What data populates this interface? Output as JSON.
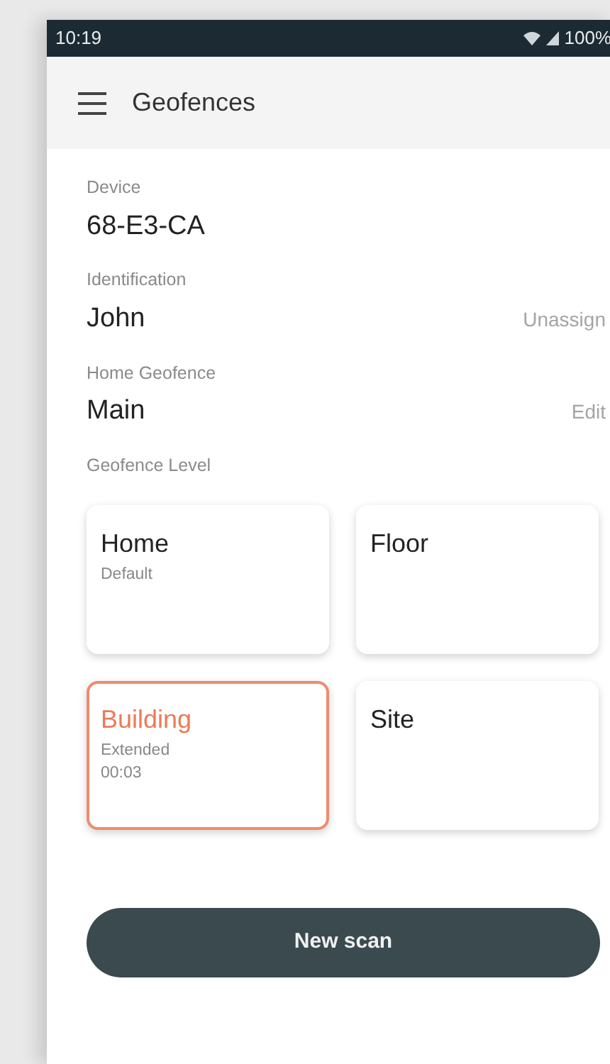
{
  "status_bar": {
    "time": "10:19",
    "battery": "100%"
  },
  "app_bar": {
    "title": "Geofences"
  },
  "fields": [
    {
      "label": "Device",
      "value": "68-E3-CA"
    },
    {
      "label": "Identification",
      "value": "John",
      "action": "Unassign"
    },
    {
      "label": "Home Geofence",
      "value": "Main",
      "action": "Edit"
    }
  ],
  "level_section": {
    "label": "Geofence Level"
  },
  "levels": [
    {
      "name": "Home",
      "lines": [
        "Default"
      ],
      "selected": false
    },
    {
      "name": "Floor",
      "selected": false
    },
    {
      "name": "Building",
      "lines": [
        "Extended",
        "00:03"
      ],
      "selected": true
    },
    {
      "name": "Site",
      "selected": false
    }
  ],
  "primary_button": {
    "label": "New scan"
  }
}
